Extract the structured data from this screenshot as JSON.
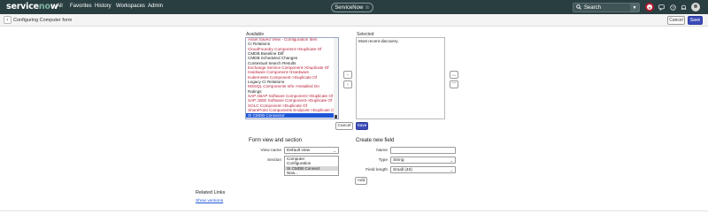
{
  "topnav": {
    "logo": "servicenow",
    "menu": [
      "All",
      "Favorites",
      "History",
      "Workspaces",
      "Admin"
    ],
    "center_pill": "ServiceNow",
    "star_icon": "star-icon",
    "search_placeholder": "Search",
    "icons": [
      "search-icon",
      "chevron-down-icon",
      "record-icon",
      "chat-icon",
      "help-icon",
      "bell-icon",
      "avatar"
    ]
  },
  "header": {
    "title": "Configuring Computer form",
    "cancel_label": "Cancel",
    "save_label": "Save"
  },
  "slushbucket": {
    "available_label": "Available",
    "selected_label": "Selected",
    "available_items": [
      {
        "text": "Asset Saved View - Configuration Item",
        "style": "red"
      },
      {
        "text": "CI Relations",
        "style": "normal"
      },
      {
        "text": "CloudFoundry Component->Duplicate Of",
        "style": "red"
      },
      {
        "text": "CMDB Baseline Diff",
        "style": "normal"
      },
      {
        "text": "CMDB Scheduled Changes",
        "style": "normal"
      },
      {
        "text": "Contextual Search Results",
        "style": "normal"
      },
      {
        "text": "Exchange Service Component->Duplicate Of",
        "style": "red"
      },
      {
        "text": "Hardware Component->Hardware",
        "style": "red"
      },
      {
        "text": "Kubernetes Component->Duplicate Of",
        "style": "red"
      },
      {
        "text": "Legacy CI Relations",
        "style": "normal"
      },
      {
        "text": "MSSQL Components Info->Installed On",
        "style": "red"
      },
      {
        "text": "Ratings",
        "style": "normal"
      },
      {
        "text": "SAP ABAP Software Component->Duplicate Of",
        "style": "red"
      },
      {
        "text": "SAP J2EE Software Component->Duplicate Of",
        "style": "red"
      },
      {
        "text": "SOLC Component->Duplicate Of",
        "style": "red"
      },
      {
        "text": "SharePoint Components Endpoint->Duplicate Of",
        "style": "red"
      },
      {
        "text": "SI CMDB Connector",
        "style": "selected"
      }
    ],
    "selected_items": [
      "Most recent discovery"
    ],
    "cancel_label": "Cancel",
    "save_label": "Save"
  },
  "form_view": {
    "heading": "Form view and section",
    "view_name_label": "View name",
    "view_name_value": "Default view",
    "section_label": "Section",
    "section_options": [
      {
        "text": "Computer",
        "selected": false
      },
      {
        "text": "Configuration",
        "selected": false
      },
      {
        "text": "SI CMDB Connect",
        "selected": true
      },
      {
        "text": "New...",
        "selected": false
      }
    ]
  },
  "create_field": {
    "heading": "Create new field",
    "name_label": "Name",
    "name_value": "",
    "type_label": "Type",
    "type_value": "String",
    "field_length_label": "Field length",
    "field_length_value": "Small (40)",
    "add_label": "Add"
  },
  "related_links": {
    "heading": "Related Links",
    "show_versions": "Show versions"
  }
}
